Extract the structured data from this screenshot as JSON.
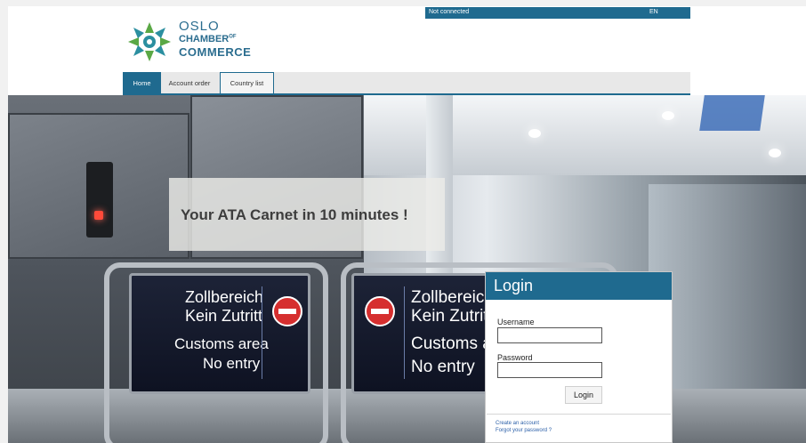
{
  "status_bar": {
    "connection": "Not connected",
    "language": "EN"
  },
  "logo": {
    "line1": "OSLO",
    "line2": "CHAMBER",
    "line2_suffix": "OF",
    "line3": "COMMERCE"
  },
  "nav": {
    "tabs": [
      {
        "label": "Home"
      },
      {
        "label": "Account order"
      },
      {
        "label": "Country list"
      }
    ]
  },
  "hero": {
    "tagline": "Your ATA Carnet in 10 minutes !",
    "sign_left": {
      "de1": "Zollbereich",
      "de2": "Kein Zutritt",
      "en1": "Customs area",
      "en2": "No entry"
    },
    "sign_right": {
      "de1": "Zollbereich",
      "de2": "Kein Zutritt",
      "en1": "Customs area",
      "en2": "No entry"
    }
  },
  "login": {
    "title": "Login",
    "username_label": "Username",
    "username_value": "",
    "password_label": "Password",
    "password_value": "",
    "submit_label": "Login",
    "create_account": "Create an account",
    "forgot_password": "Forgot your password ?"
  },
  "colors": {
    "brand": "#1f6a8f",
    "logo_green": "#5aa845",
    "logo_teal": "#2b8fa0"
  }
}
